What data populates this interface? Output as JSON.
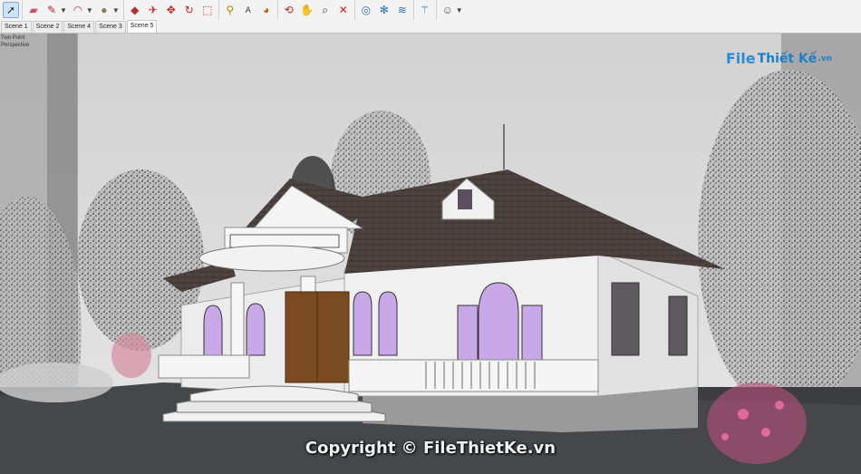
{
  "toolbar": {
    "groups": [
      [
        "select-icon"
      ],
      [
        "eraser-icon",
        "pencil-icon",
        "arc-icon",
        "paint-bucket-icon"
      ],
      [
        "push-pull-icon",
        "follow-me-icon",
        "move-icon",
        "rotate-icon",
        "scale-icon"
      ],
      [
        "tape-measure-icon",
        "text-icon",
        "paint-icon"
      ],
      [
        "orbit-icon",
        "pan-icon",
        "zoom-icon",
        "zoom-extents-icon"
      ],
      [
        "warehouse-icon",
        "extension-icon",
        "layers-icon"
      ],
      [
        "sandbox-icon"
      ],
      [
        "account-icon"
      ]
    ]
  },
  "tabs": [
    "Scene 1",
    "Scene 2",
    "Scene 4",
    "Scene 3",
    "Scene 5"
  ],
  "active_tab": "Scene 5",
  "viewport": {
    "camera_label_1": "Two Point",
    "camera_label_2": "Perspective"
  },
  "watermark": {
    "logo_part1": "File",
    "logo_part2": "Thiết Kế",
    "logo_suffix": ".vn",
    "copyright": "Copyright © FileThietKe.vn"
  },
  "colors": {
    "roof": "#4a3f3d",
    "wall": "#f2f2f2",
    "window_glass": "#c9a8e8",
    "door_wood": "#7a4a22",
    "accent_blue": "#2a8dd6"
  }
}
